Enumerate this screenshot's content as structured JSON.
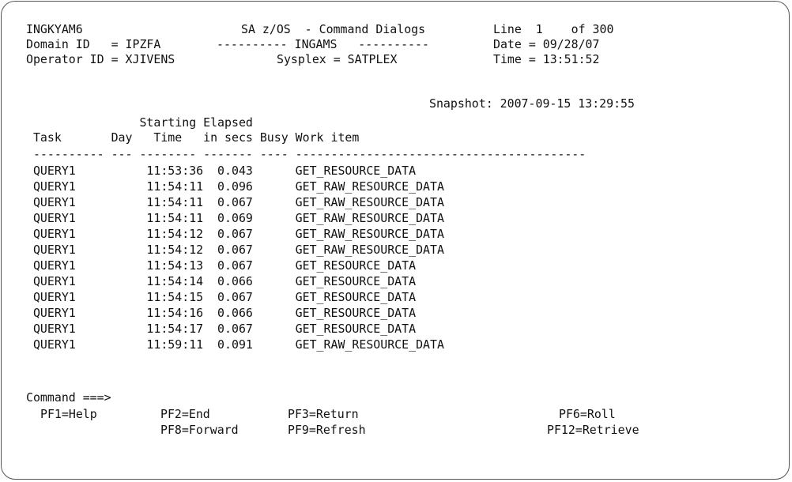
{
  "header": {
    "panel_id": "INGKYAM6",
    "title": "SA z/OS  - Command Dialogs",
    "line_info": "Line  1    of 300",
    "domain_label": "Domain ID   = IPZFA",
    "subtitle": "---------- INGAMS   ----------",
    "date_label": "Date = 09/28/07",
    "operator_label": "Operator ID = XJIVENS",
    "sysplex_label": "Sysplex = SATPLEX",
    "time_label": "Time = 13:51:52"
  },
  "snapshot": "Snapshot: 2007-09-15 13:29:55",
  "table": {
    "header_line1": "                Starting Elapsed",
    "header_line2": " Task       Day   Time   in secs Busy Work item",
    "separator": " ---------- --- -------- ------- ---- -----------------------------------------",
    "rows": [
      " QUERY1          11:53:36  0.043      GET_RESOURCE_DATA",
      " QUERY1          11:54:11  0.096      GET_RAW_RESOURCE_DATA",
      " QUERY1          11:54:11  0.067      GET_RAW_RESOURCE_DATA",
      " QUERY1          11:54:11  0.069      GET_RAW_RESOURCE_DATA",
      " QUERY1          11:54:12  0.067      GET_RAW_RESOURCE_DATA",
      " QUERY1          11:54:12  0.067      GET_RAW_RESOURCE_DATA",
      " QUERY1          11:54:13  0.067      GET_RESOURCE_DATA",
      " QUERY1          11:54:14  0.066      GET_RESOURCE_DATA",
      " QUERY1          11:54:15  0.067      GET_RESOURCE_DATA",
      " QUERY1          11:54:16  0.066      GET_RESOURCE_DATA",
      " QUERY1          11:54:17  0.067      GET_RESOURCE_DATA",
      " QUERY1          11:59:11  0.091      GET_RAW_RESOURCE_DATA"
    ]
  },
  "command": {
    "prompt": "Command ===>"
  },
  "pfkeys": {
    "help": "PF1=Help",
    "end": "PF2=End",
    "return": "PF3=Return",
    "roll": "PF6=Roll",
    "forward": "PF8=Forward",
    "refresh": "PF9=Refresh",
    "retrieve": "PF12=Retrieve"
  }
}
